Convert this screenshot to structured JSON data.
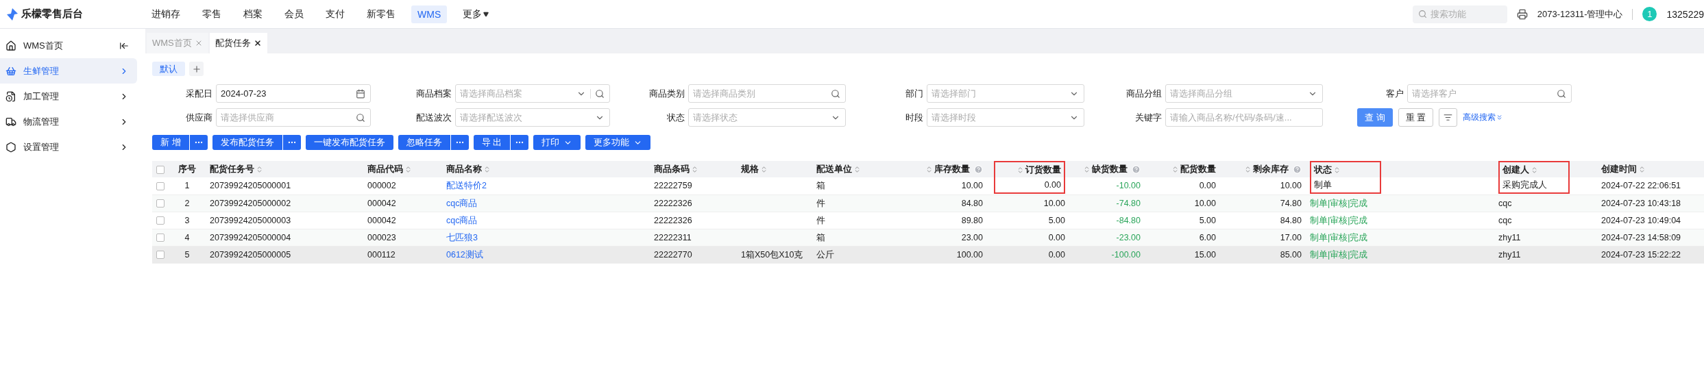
{
  "brand": {
    "name": "乐檬零售后台"
  },
  "top_nav": [
    {
      "label": "进销存",
      "selected": false,
      "kind": "link"
    },
    {
      "label": "零售",
      "selected": false,
      "kind": "link"
    },
    {
      "label": "档案",
      "selected": false,
      "kind": "link"
    },
    {
      "label": "会员",
      "selected": false,
      "kind": "link"
    },
    {
      "label": "支付",
      "selected": false,
      "kind": "link"
    },
    {
      "label": "新零售",
      "selected": false,
      "kind": "link"
    },
    {
      "label": "WMS",
      "selected": true,
      "kind": "link"
    },
    {
      "label": "更多",
      "selected": false,
      "kind": "menu"
    }
  ],
  "header": {
    "search": {
      "placeholder": "搜索功能"
    },
    "store": "2073-12311-管理中心",
    "user": {
      "badge": "1",
      "name": "1325229"
    }
  },
  "sidebar": {
    "items": [
      {
        "label": "WMS首页",
        "selected": false,
        "kind": "home"
      },
      {
        "label": "生鲜管理",
        "selected": true,
        "kind": "group"
      },
      {
        "label": "加工管理",
        "selected": false,
        "kind": "group"
      },
      {
        "label": "物流管理",
        "selected": false,
        "kind": "group"
      },
      {
        "label": "设置管理",
        "selected": false,
        "kind": "group"
      }
    ]
  },
  "tabs": [
    {
      "label": "WMS首页",
      "selected": false
    },
    {
      "label": "配货任务",
      "selected": true
    }
  ],
  "views": [
    {
      "label": "默认",
      "selected": true
    }
  ],
  "filters": [
    [
      {
        "label": "采配日",
        "kind": "date",
        "value": "2024-07-23"
      },
      {
        "label": "商品档案",
        "kind": "select_search",
        "placeholder": "请选择商品档案"
      },
      {
        "label": "商品类别",
        "kind": "search",
        "placeholder": "请选择商品类别"
      },
      {
        "label": "部门",
        "kind": "select",
        "placeholder": "请选择部门"
      },
      {
        "label": "商品分组",
        "kind": "select",
        "placeholder": "请选择商品分组"
      },
      {
        "label": "客户",
        "kind": "search",
        "placeholder": "请选择客户"
      }
    ],
    [
      {
        "label": "供应商",
        "kind": "search",
        "placeholder": "请选择供应商"
      },
      {
        "label": "配送波次",
        "kind": "select",
        "placeholder": "请选择配送波次"
      },
      {
        "label": "状态",
        "kind": "select",
        "placeholder": "请选择状态"
      },
      {
        "label": "时段",
        "kind": "select",
        "placeholder": "请选择时段"
      },
      {
        "label": "关键字",
        "kind": "text",
        "placeholder": "请输入商品名称/代码/条码/速..."
      }
    ]
  ],
  "query_buttons": {
    "query": "查 询",
    "reset": "重 置",
    "advanced": "高级搜索"
  },
  "actions": [
    {
      "label": "新 增",
      "kind": "split"
    },
    {
      "label": "发布配货任务",
      "kind": "split"
    },
    {
      "label": "一键发布配货任务",
      "kind": "single"
    },
    {
      "label": "忽略任务",
      "kind": "split"
    },
    {
      "label": "导 出",
      "kind": "split"
    },
    {
      "label": "打印",
      "kind": "dropdown"
    },
    {
      "label": "更多功能",
      "kind": "dropdown"
    }
  ],
  "table": {
    "all_checked": false,
    "columns": [
      {
        "label": "序号",
        "kind": "index",
        "sortable": false,
        "info": false,
        "highlighted": false
      },
      {
        "label": "配货任务号",
        "kind": "text",
        "sortable": true,
        "info": false,
        "highlighted": false
      },
      {
        "label": "商品代码",
        "kind": "text",
        "sortable": true,
        "info": false,
        "highlighted": false
      },
      {
        "label": "商品名称",
        "kind": "link",
        "sortable": true,
        "info": false,
        "highlighted": false
      },
      {
        "label": "商品条码",
        "kind": "text",
        "sortable": true,
        "info": false,
        "highlighted": false
      },
      {
        "label": "规格",
        "kind": "text",
        "sortable": true,
        "info": false,
        "highlighted": false
      },
      {
        "label": "配送单位",
        "kind": "text",
        "sortable": true,
        "info": false,
        "highlighted": false
      },
      {
        "label": "库存数量",
        "kind": "number",
        "sortable": true,
        "info": true,
        "highlighted": false
      },
      {
        "label": "订货数量",
        "kind": "number",
        "sortable": true,
        "info": false,
        "highlighted": true
      },
      {
        "label": "缺货数量",
        "kind": "shortage",
        "sortable": true,
        "info": true,
        "highlighted": false
      },
      {
        "label": "配货数量",
        "kind": "number",
        "sortable": true,
        "info": false,
        "highlighted": false
      },
      {
        "label": "剩余库存",
        "kind": "number",
        "sortable": true,
        "info": true,
        "highlighted": false
      },
      {
        "label": "状态",
        "kind": "status",
        "sortable": true,
        "info": false,
        "highlighted": true
      },
      {
        "label": "创建人",
        "kind": "text",
        "sortable": true,
        "info": false,
        "highlighted": true
      },
      {
        "label": "创建时间",
        "kind": "text",
        "sortable": true,
        "info": false,
        "highlighted": false
      }
    ],
    "rows": [
      {
        "checked": false,
        "hovered": false,
        "status_done": false,
        "cells": [
          "1",
          "20739924205000001",
          "000002",
          "配送特价2",
          "22222759",
          null,
          "箱",
          "10.00",
          "0.00",
          "-10.00",
          "0.00",
          "10.00",
          "制单",
          "采购完成人",
          "2024-07-22 22:06:51"
        ]
      },
      {
        "checked": false,
        "hovered": false,
        "status_done": true,
        "cells": [
          "2",
          "20739924205000002",
          "000042",
          "cqc商品",
          "22222326",
          null,
          "件",
          "84.80",
          "10.00",
          "-74.80",
          "10.00",
          "74.80",
          "制单|审核|完成",
          "cqc",
          "2024-07-23 10:43:18"
        ]
      },
      {
        "checked": false,
        "hovered": false,
        "status_done": true,
        "cells": [
          "3",
          "20739924205000003",
          "000042",
          "cqc商品",
          "22222326",
          null,
          "件",
          "89.80",
          "5.00",
          "-84.80",
          "5.00",
          "84.80",
          "制单|审核|完成",
          "cqc",
          "2024-07-23 10:49:04"
        ]
      },
      {
        "checked": false,
        "hovered": false,
        "status_done": true,
        "cells": [
          "4",
          "20739924205000004",
          "000023",
          "七匹狼3",
          "22222311",
          null,
          "箱",
          "23.00",
          "0.00",
          "-23.00",
          "6.00",
          "17.00",
          "制单|审核|完成",
          "zhy11",
          "2024-07-23 14:58:09"
        ]
      },
      {
        "checked": false,
        "hovered": true,
        "status_done": true,
        "cells": [
          "5",
          "20739924205000005",
          "000112",
          "0612测试",
          "22222770",
          "1箱X50包X10克",
          "公斤",
          "100.00",
          "0.00",
          "-100.00",
          "15.00",
          "85.00",
          "制单|审核|完成",
          "zhy11",
          "2024-07-23 15:22:22"
        ]
      }
    ]
  }
}
